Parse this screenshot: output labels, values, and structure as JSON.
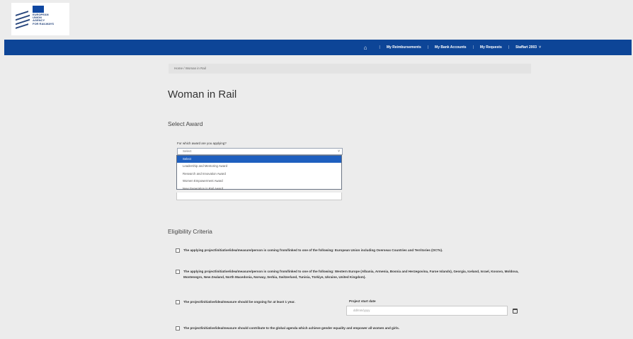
{
  "header": {
    "logo_text": "EUROPEAN\nUNION\nAGENCY\nFOR RAILWAYS"
  },
  "nav": {
    "items": [
      "My Reimbursements",
      "My Bank Accounts",
      "My Requests",
      "Staffart 2003"
    ]
  },
  "breadcrumb": {
    "text": "Home / Woman in Rail"
  },
  "page": {
    "title": "Woman in Rail",
    "select_award_heading": "Select Award",
    "award_question": "For which award are you applying?",
    "award_selected": "Select",
    "award_options": [
      "Select",
      "Leadership and Mentoring Award",
      "Research and Innovation Award",
      "Women Empowerment Award",
      "New Generation in Rail Award"
    ],
    "eligibility_heading": "Eligibility Criteria",
    "criteria": [
      "The applying project/initiative/idea/measure/person is coming from/linked to one of the following: European Union including Overseas Countries and Territories (OCTs).",
      "The applying project/initiative/idea/measure/person is coming from/linked to one of the following: Western Europe (Albania, Armenia, Bosnia and Herzegovina, Faroe Islands), Georgia, Iceland, Israel, Kosovo, Moldova, Montenegro, New Zealand, North Macedonia, Norway, Serbia, Switzerland, Tunisia, Türkiye, Ukraine, United Kingdom).",
      "The project/initiative/idea/measure should be ongoing for at least 1 year.",
      "The project/initiative/idea/measure should contribute to the global agenda which achieve gender equality and empower all women and girls."
    ],
    "start_date_label": "Project start date",
    "start_date_placeholder": "dd/mm/yyyy"
  },
  "colors": {
    "navbar": "#0d4597",
    "selected_option": "#1e5fbf",
    "background": "#ececec"
  }
}
